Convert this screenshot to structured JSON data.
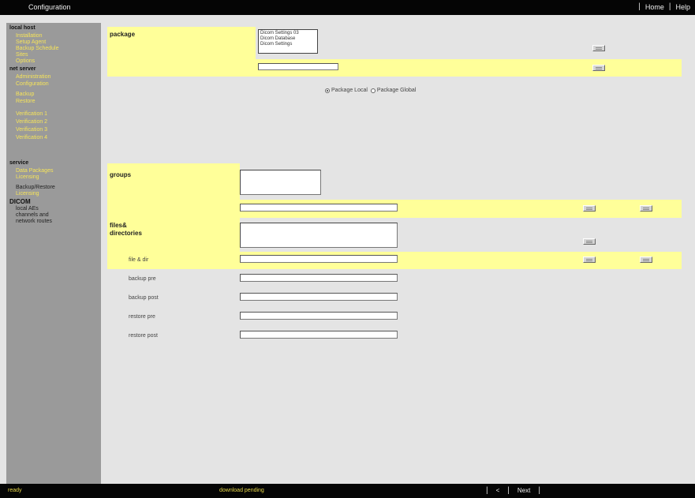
{
  "app": {
    "title": "Configuration"
  },
  "top_nav": {
    "home": "Home",
    "help": "Help"
  },
  "sidebar": {
    "local_host": {
      "title": "local host",
      "items": [
        "Installation",
        "Setup Agent",
        "Backup Schedule",
        "Sites",
        "Options"
      ]
    },
    "net_server": {
      "title": "net server",
      "items": [
        "Administration",
        "Configuration",
        "Backup",
        "Restore",
        "Verification 1",
        "Verification 2",
        "Verification 3",
        "Verification 4"
      ]
    },
    "service": {
      "title": "service",
      "items": [
        "Data Packages",
        "Licensing"
      ]
    },
    "service_plain": "Backup/Restore",
    "service_link2": "Licensing",
    "dicom": {
      "title": "DICOM",
      "lines": [
        "local AEs",
        "channels and",
        "network routes"
      ]
    }
  },
  "form": {
    "package": {
      "label": "package",
      "options": [
        "Dicom Settings 03",
        "Dicom Database",
        "Dicom Settings"
      ],
      "name_value": ""
    },
    "scope": {
      "local_label": "Package Local",
      "global_label": "Package Global",
      "selected": "local"
    },
    "groups": {
      "label": "groups",
      "value": ""
    },
    "files": {
      "label_line1": "files&",
      "label_line2": "directories"
    },
    "file_dir": {
      "label": "file & dir",
      "value": ""
    },
    "backup_pre": {
      "label": "backup pre",
      "value": ""
    },
    "backup_post": {
      "label": "backup post",
      "value": ""
    },
    "restore_pre": {
      "label": "restore pre",
      "value": ""
    },
    "restore_post": {
      "label": "restore post",
      "value": ""
    }
  },
  "status": {
    "left": "ready",
    "middle": "download pending",
    "prev": "<",
    "next": "Next"
  },
  "colors": {
    "highlight": "#ffff99",
    "sidebar_bg": "#9a9a9a",
    "link": "#f6e45a",
    "bar": "#050505"
  }
}
